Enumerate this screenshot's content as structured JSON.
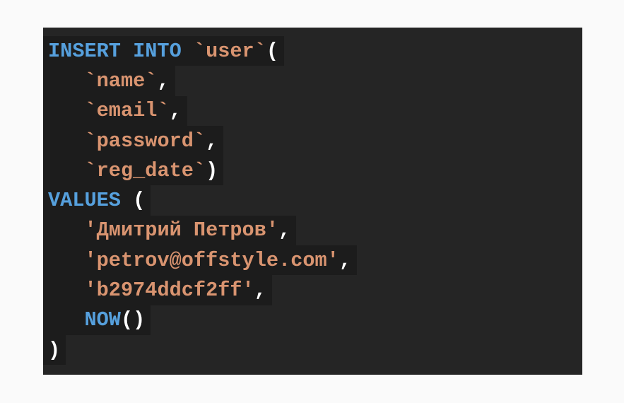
{
  "code": {
    "lines": [
      {
        "tokens": [
          {
            "t": "INSERT INTO ",
            "c": "kw"
          },
          {
            "t": "`user`",
            "c": "str"
          },
          {
            "t": "(",
            "c": "pn"
          }
        ]
      },
      {
        "indent": "   ",
        "tokens": [
          {
            "t": "`name`",
            "c": "str"
          },
          {
            "t": ",",
            "c": "pn"
          }
        ]
      },
      {
        "indent": "   ",
        "tokens": [
          {
            "t": "`email`",
            "c": "str"
          },
          {
            "t": ",",
            "c": "pn"
          }
        ]
      },
      {
        "indent": "   ",
        "tokens": [
          {
            "t": "`password`",
            "c": "str"
          },
          {
            "t": ",",
            "c": "pn"
          }
        ]
      },
      {
        "indent": "   ",
        "tokens": [
          {
            "t": "`reg_date`",
            "c": "str"
          },
          {
            "t": ")",
            "c": "pn"
          }
        ]
      },
      {
        "tokens": [
          {
            "t": "VALUES ",
            "c": "kw"
          },
          {
            "t": "(",
            "c": "pn"
          }
        ]
      },
      {
        "indent": "   ",
        "tokens": [
          {
            "t": "'Дмитрий Петров'",
            "c": "str"
          },
          {
            "t": ",",
            "c": "pn"
          }
        ]
      },
      {
        "indent": "   ",
        "tokens": [
          {
            "t": "'petrov@offstyle.com'",
            "c": "str"
          },
          {
            "t": ",",
            "c": "pn"
          }
        ]
      },
      {
        "indent": "   ",
        "tokens": [
          {
            "t": "'b2974ddcf2ff'",
            "c": "str"
          },
          {
            "t": ",",
            "c": "pn"
          }
        ]
      },
      {
        "indent": "   ",
        "tokens": [
          {
            "t": "NOW",
            "c": "kw"
          },
          {
            "t": "()",
            "c": "pn"
          }
        ]
      },
      {
        "tokens": [
          {
            "t": ")",
            "c": "pn"
          }
        ]
      }
    ]
  },
  "colors": {
    "background": "#fafafa",
    "code_background": "#252525",
    "line_highlight": "#1c1c1c",
    "keyword": "#56a0dd",
    "string": "#d99470",
    "punctuation": "#ffffff"
  }
}
